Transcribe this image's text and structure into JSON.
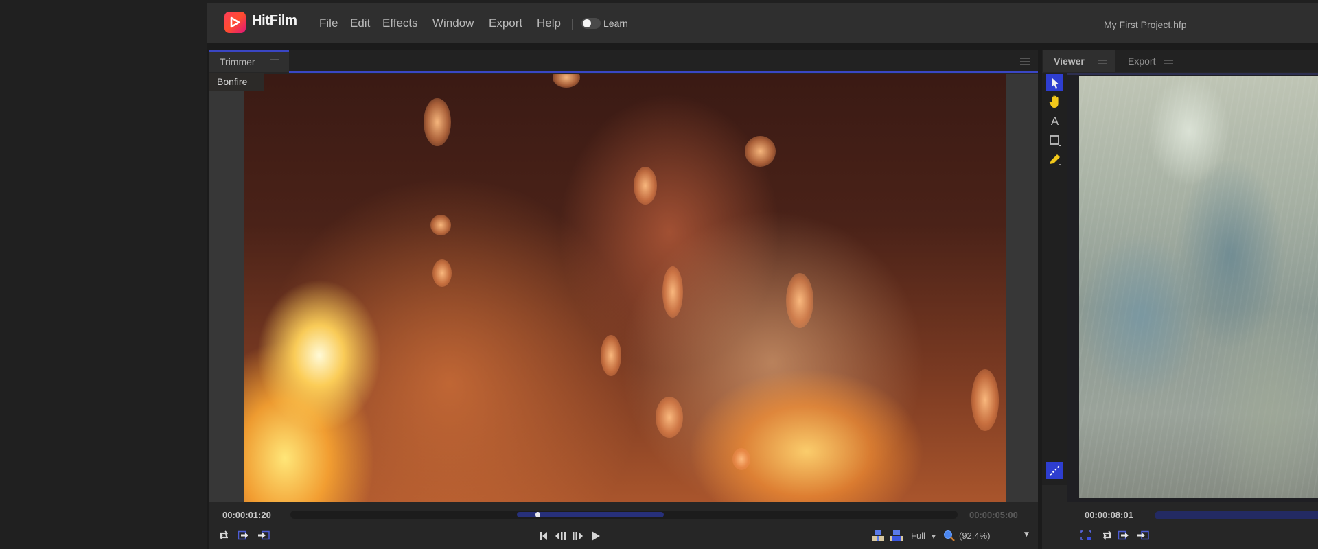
{
  "app": {
    "name": "HitFilm",
    "project_title": "My First Project.hfp",
    "brand_color": "#ff3d5a",
    "accent_color": "#3a46c4"
  },
  "menu": {
    "items": [
      {
        "label": "File"
      },
      {
        "label": "Edit"
      },
      {
        "label": "Effects"
      },
      {
        "label": "Window"
      },
      {
        "label": "Export"
      },
      {
        "label": "Help"
      }
    ],
    "learn_toggle": {
      "label": "Learn",
      "on": false
    }
  },
  "trimmer": {
    "tab_label": "Trimmer",
    "clip_name": "Bonfire",
    "current_time": "00:00:01:20",
    "duration": "00:00:05:00",
    "playhead_fraction": 0.37,
    "range_start_fraction": 0.34,
    "range_end_fraction": 0.56,
    "quality": "Full",
    "zoom": "(92.4%)",
    "left_icons": [
      "loop-icon",
      "set-in-icon",
      "set-out-icon"
    ],
    "transport": [
      "go-to-start-icon",
      "step-back-icon",
      "step-forward-icon",
      "play-icon"
    ],
    "view_icons": [
      "insert-clip-icon",
      "overlay-clip-icon"
    ]
  },
  "viewer": {
    "tabs": [
      {
        "label": "Viewer",
        "active": true
      },
      {
        "label": "Export",
        "active": false
      }
    ],
    "current_time": "00:00:08:01",
    "tools": [
      "selection-tool-icon",
      "hand-tool-icon",
      "text-tool-icon",
      "mask-tool-icon",
      "pen-tool-icon"
    ],
    "bottom_tool": "motion-path-icon",
    "bottom_icons": [
      "fullscreen-icon",
      "loop-icon",
      "set-in-icon",
      "set-out-icon"
    ]
  }
}
